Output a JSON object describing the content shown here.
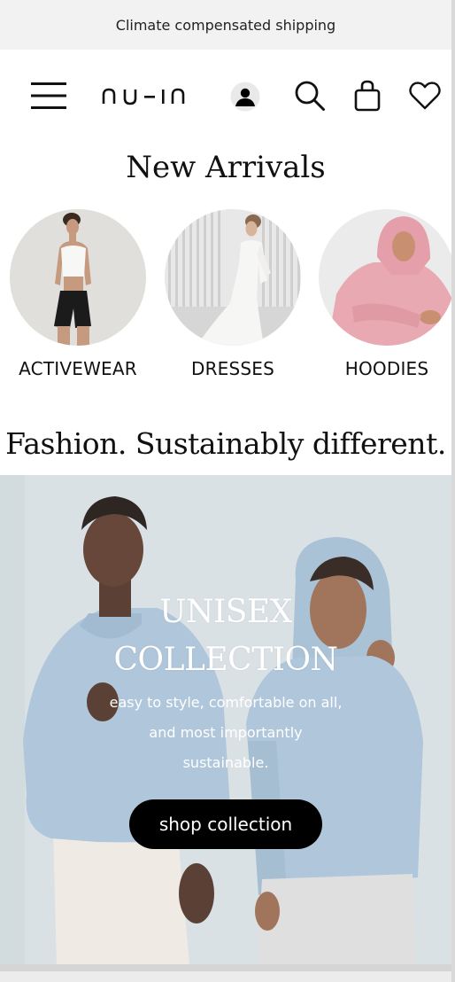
{
  "announcement": {
    "text": "Climate compensated shipping"
  },
  "header": {
    "logo_text": "nu-in",
    "icons": [
      "menu-icon",
      "account-icon",
      "search-icon",
      "bag-icon",
      "heart-icon"
    ]
  },
  "new_arrivals": {
    "title": "New Arrivals",
    "categories": [
      {
        "label": "ACTIVEWEAR"
      },
      {
        "label": "DRESSES"
      },
      {
        "label": "HOODIES"
      }
    ]
  },
  "tagline": "Fashion. Sustainably different.",
  "hero": {
    "title_line1": "UNISEX",
    "title_line2": "COLLECTION",
    "subtitle_lines": [
      "easy to style, comfortable on all,",
      "and most importantly",
      "sustainable."
    ],
    "cta_label": "shop collection"
  },
  "colors": {
    "announcement_bg": "#f2f2f2",
    "hoodie_blue": "#a9c2d8",
    "cta_bg": "#000000",
    "hero_bg": "#d7dfe3"
  }
}
